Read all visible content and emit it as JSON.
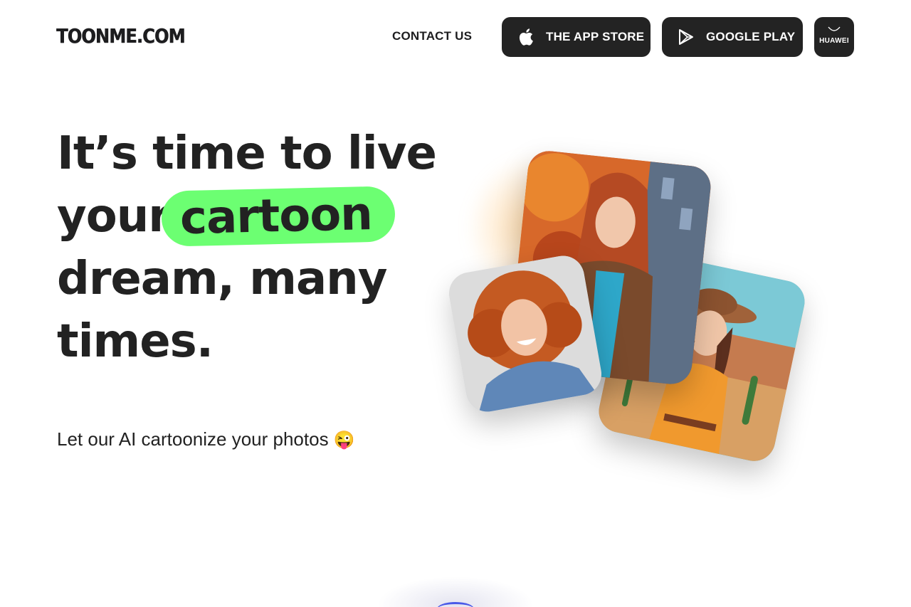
{
  "header": {
    "logo": "TOONME.COM",
    "contact_label": "CONTACT US",
    "app_store_label": "THE APP STORE",
    "google_play_label": "GOOGLE PLAY",
    "huawei_label": "HUAWEI"
  },
  "hero": {
    "line1": "It’s time to live",
    "line2_prefix": "your",
    "line2_highlight": "cartoon",
    "line3": "dream, many",
    "line4": "times.",
    "subtitle": "Let our AI cartoonize your photos",
    "subtitle_emoji": "😜",
    "highlight_color": "#6cff72"
  },
  "icons": [
    "apple-icon",
    "google-play-icon",
    "huawei-icon"
  ],
  "colors": {
    "button_bg": "#232323",
    "text": "#222222"
  }
}
